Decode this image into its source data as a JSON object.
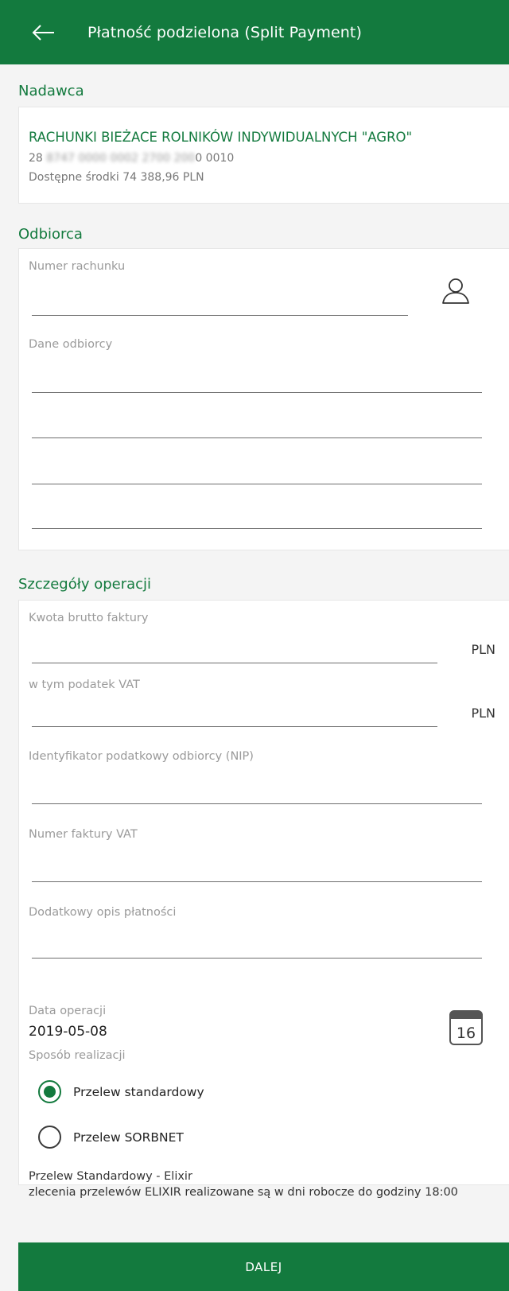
{
  "header": {
    "title": "Płatność podzielona (Split Payment)"
  },
  "sender": {
    "section_title": "Nadawca",
    "account_name": "RACHUNKI BIEŻACE ROLNIKÓW INDYWIDUALNYCH \"AGRO\"",
    "account_prefix": "28 ",
    "account_masked": "8747 0000 0002 2700 200",
    "account_suffix": "0 0010",
    "available_funds": "Dostępne środki 74 388,96 PLN"
  },
  "recipient": {
    "section_title": "Odbiorca",
    "account_number_label": "Numer rachunku",
    "account_number_value": "",
    "recipient_data_label": "Dane odbiorcy",
    "recipient_lines": [
      "",
      "",
      "",
      ""
    ]
  },
  "details": {
    "section_title": "Szczegóły operacji",
    "gross_amount_label": "Kwota brutto faktury",
    "gross_amount_value": "",
    "vat_label": "w tym podatek VAT",
    "vat_value": "",
    "currency": "PLN",
    "nip_label": "Identyfikator podatkowy odbiorcy (NIP)",
    "nip_value": "",
    "invoice_label": "Numer faktury VAT",
    "invoice_value": "",
    "description_label": "Dodatkowy opis płatności",
    "description_value": "",
    "date_label": "Data operacji",
    "date_value": "2019-05-08",
    "calendar_day": "16",
    "method_label": "Sposób realizacji",
    "methods": [
      {
        "label": "Przelew standardowy",
        "selected": true
      },
      {
        "label": "Przelew SORBNET",
        "selected": false
      }
    ],
    "info_line1": "Przelew Standardowy - Elixir",
    "info_line2": "zlecenia przelewów ELIXIR realizowane są w dni robocze do godziny 18:00"
  },
  "actions": {
    "next_label": "DALEJ"
  },
  "colors": {
    "brand": "#137a3e",
    "background": "#f4f4f4"
  }
}
